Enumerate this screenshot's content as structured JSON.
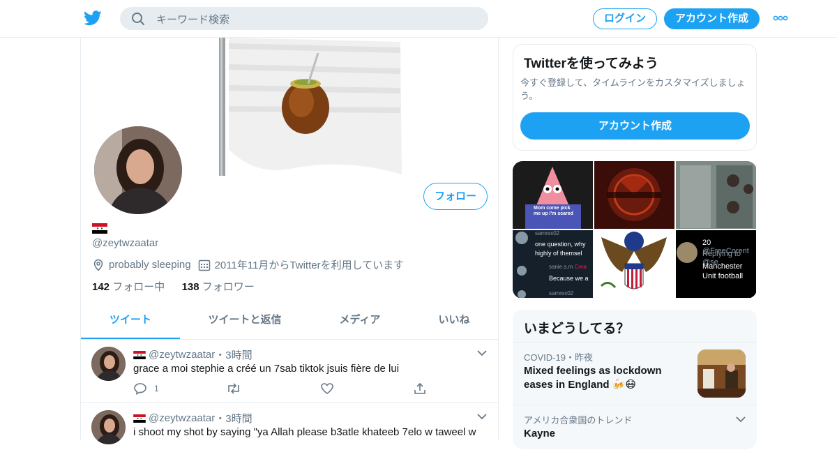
{
  "header": {
    "search_placeholder": "キーワード検索",
    "login_label": "ログイン",
    "signup_label": "アカウント作成",
    "brand_color": "#1da1f2"
  },
  "profile": {
    "handle": "@zeytwzaatar",
    "location": "probably sleeping",
    "joined": "2011年11月からTwitterを利用しています",
    "following_count": "142",
    "following_label": "フォロー中",
    "followers_count": "138",
    "followers_label": "フォロワー",
    "follow_button": "フォロー"
  },
  "tabs": [
    {
      "label": "ツイート",
      "active": true
    },
    {
      "label": "ツイートと返信",
      "active": false
    },
    {
      "label": "メディア",
      "active": false
    },
    {
      "label": "いいね",
      "active": false
    }
  ],
  "tweets": [
    {
      "handle": "@zeytwzaatar",
      "sep": "・",
      "time": "3時間",
      "text": "grace a moi stephie a créé un 7sab tiktok jsuis fière de lui",
      "reply_count": "1"
    },
    {
      "handle": "@zeytwzaatar",
      "sep": "・",
      "time": "3時間",
      "text": "i shoot my shot by saying \"ya Allah please b3atle khateeb 7elo w taweel w",
      "reply_count": ""
    }
  ],
  "signup_card": {
    "title": "Twitterを使ってみよう",
    "subtitle": "今すぐ登録して、タイムラインをカスタマイズしましょう。",
    "button": "アカウント作成"
  },
  "media_grid": {
    "cell1_text": "Mom come pick me up I'm scared",
    "cell4_user": "samrex02",
    "cell4_text": "one question, why highly of themsel",
    "cell4_user2": "sanie.s.m",
    "cell4_tag": "Crea",
    "cell4_reply": "Because we a",
    "cell4_user3": "samrex02",
    "cell6_count": "20",
    "cell6_handle": "@FreeCorent",
    "cell6_reply": "Replying to @se",
    "cell6_text": "Manchester Unit football"
  },
  "trends": {
    "title": "いまどうしてる？",
    "items": [
      {
        "category": "COVID-19",
        "sep": "・",
        "time": "昨夜",
        "headline": "Mixed feelings as lockdown eases in England 🍻😷"
      },
      {
        "category": "アメリカ合衆国のトレンド",
        "headline": "Kayne"
      }
    ]
  }
}
